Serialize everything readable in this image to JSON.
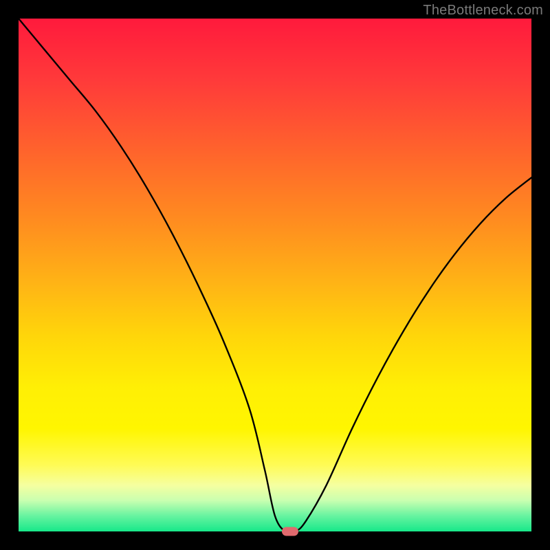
{
  "watermark": "TheBottleneck.com",
  "chart_data": {
    "type": "line",
    "title": "",
    "xlabel": "",
    "ylabel": "",
    "xlim": [
      0,
      100
    ],
    "ylim": [
      0,
      100
    ],
    "x": [
      0,
      5,
      10,
      15,
      20,
      25,
      30,
      35,
      40,
      45,
      48,
      50,
      52,
      54,
      56,
      60,
      65,
      70,
      75,
      80,
      85,
      90,
      95,
      100
    ],
    "values": [
      100,
      94,
      88,
      82,
      75,
      67,
      58,
      48,
      37,
      24,
      12,
      3,
      0,
      0,
      2,
      9,
      20,
      30,
      39,
      47,
      54,
      60,
      65,
      69
    ],
    "marker": {
      "x": 53,
      "y": 0
    },
    "gradient_stops": [
      {
        "pos": 0.0,
        "color": "#ff1a3c"
      },
      {
        "pos": 0.5,
        "color": "#ffc010"
      },
      {
        "pos": 0.8,
        "color": "#fff600"
      },
      {
        "pos": 1.0,
        "color": "#17e88a"
      }
    ]
  }
}
